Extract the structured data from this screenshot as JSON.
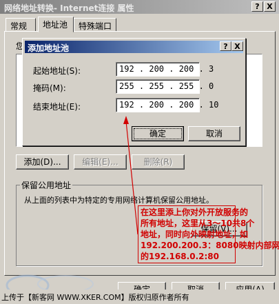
{
  "window": {
    "title": "网络地址转换- Internet连接 属性",
    "help_btn": "?",
    "close_btn": "X"
  },
  "tabs": [
    {
      "label": "常规"
    },
    {
      "label": "地址池"
    },
    {
      "label": "特殊端口"
    }
  ],
  "panel": {
    "pool_label": "您",
    "add_button": "添加(D)...",
    "edit_button": "编辑(E)...",
    "delete_button": "删除(R)",
    "reserve_group_title": "保留公用地址",
    "reserve_desc": "从上面的列表中为特定的专用网络计算机保留公用地址。",
    "reserve_button": "保留(V)..."
  },
  "add_pool_dialog": {
    "title": "添加地址池",
    "help_btn": "?",
    "close_btn": "X",
    "start_label": "起始地址(S):",
    "start_value": "192 . 200 . 200 .  3",
    "mask_label": "掩码(M):",
    "mask_value": "255 . 255 . 255 .  0",
    "end_label": "结束地址(E):",
    "end_value": "192 . 200 . 200 . 10",
    "ok_button": "确定",
    "cancel_button": "取消"
  },
  "bottom_buttons": {
    "ok": "确定",
    "cancel": "取消",
    "apply": "应用(A)"
  },
  "annotation": {
    "lines": [
      "在这里添上你对外开放服务的",
      "所有地址，这里从3～10共8个",
      "地址，同时向外映射地址，如",
      "192.200.200.3：8080映射内部网",
      "的192.168.0.2:80"
    ]
  },
  "footer": {
    "text": "上传于【新客网 WWW.XKER.COM】版权归原作者所有"
  },
  "colors": {
    "window_bg": "#d4d0c8",
    "active_title": "#0a246a",
    "annotation_red": "#d10000"
  }
}
